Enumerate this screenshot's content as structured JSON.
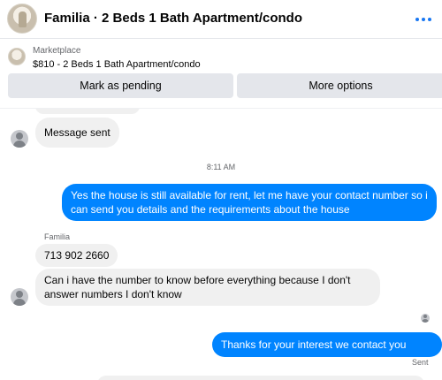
{
  "header": {
    "title": "Familia · 2 Beds 1 Bath Apartment/condo",
    "avatar_icon": "house-photo-avatar",
    "more_icon": "more-options-icon"
  },
  "banner": {
    "label": "Marketplace",
    "item": "$810 - 2 Beds 1 Bath Apartment/condo",
    "mark_pending_label": "Mark as pending",
    "more_options_label": "More options"
  },
  "thread": {
    "messages": [
      {
        "direction": "incoming",
        "text": "Message sent"
      },
      {
        "type": "timestamp",
        "text": "8:11 AM"
      },
      {
        "direction": "outgoing",
        "text": "Yes the house is still available for rent, let me have your contact number so i can send you details and the requirements about the house"
      },
      {
        "type": "sender",
        "text": "Familia"
      },
      {
        "direction": "incoming",
        "text": "713 902 2660"
      },
      {
        "direction": "incoming",
        "text": "Can i have the number to know before everything because I don't answer  numbers I don't know"
      },
      {
        "direction": "outgoing",
        "text": "Thanks for your interest we contact you soon."
      },
      {
        "type": "status",
        "text": "Sent"
      }
    ]
  },
  "colors": {
    "outgoing_bubble": "#0084ff",
    "incoming_bubble": "#f0f0f0",
    "button_bg": "#e4e6eb",
    "accent": "#1877f2"
  }
}
